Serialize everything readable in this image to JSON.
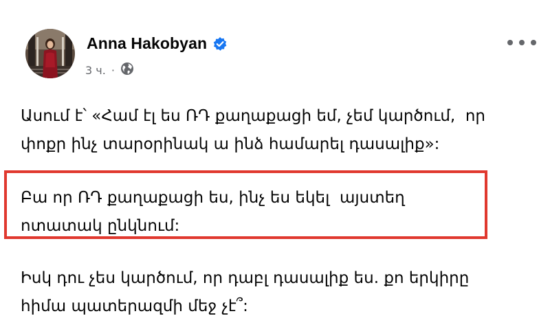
{
  "post": {
    "author": {
      "name": "Anna Hakobyan",
      "verified": true
    },
    "meta": {
      "time": "3 ч.",
      "separator": "·",
      "audience_icon": "globe-icon"
    },
    "paragraphs": [
      "Ասում է՝ «Համ էլ ես ՌԴ քաղաքացի եմ, չեմ կարծում,  որ\nփոքր ինչ տարօրինակ ա ինձ համարել դասալիք»:",
      "Բա որ ՌԴ քաղաքացի ես, ինչ ես եկել  այստեղ\nոտատակ ընկնում:",
      "Իսկ դու չես կարծում, որ դաբլ դասալիք ես. քո երկիրը\nհիմա պատերազմի մեջ չէ՞:"
    ]
  },
  "colors": {
    "verified_badge": "#1877f2",
    "highlight_border": "#e0382e",
    "meta_text": "#65676b"
  }
}
